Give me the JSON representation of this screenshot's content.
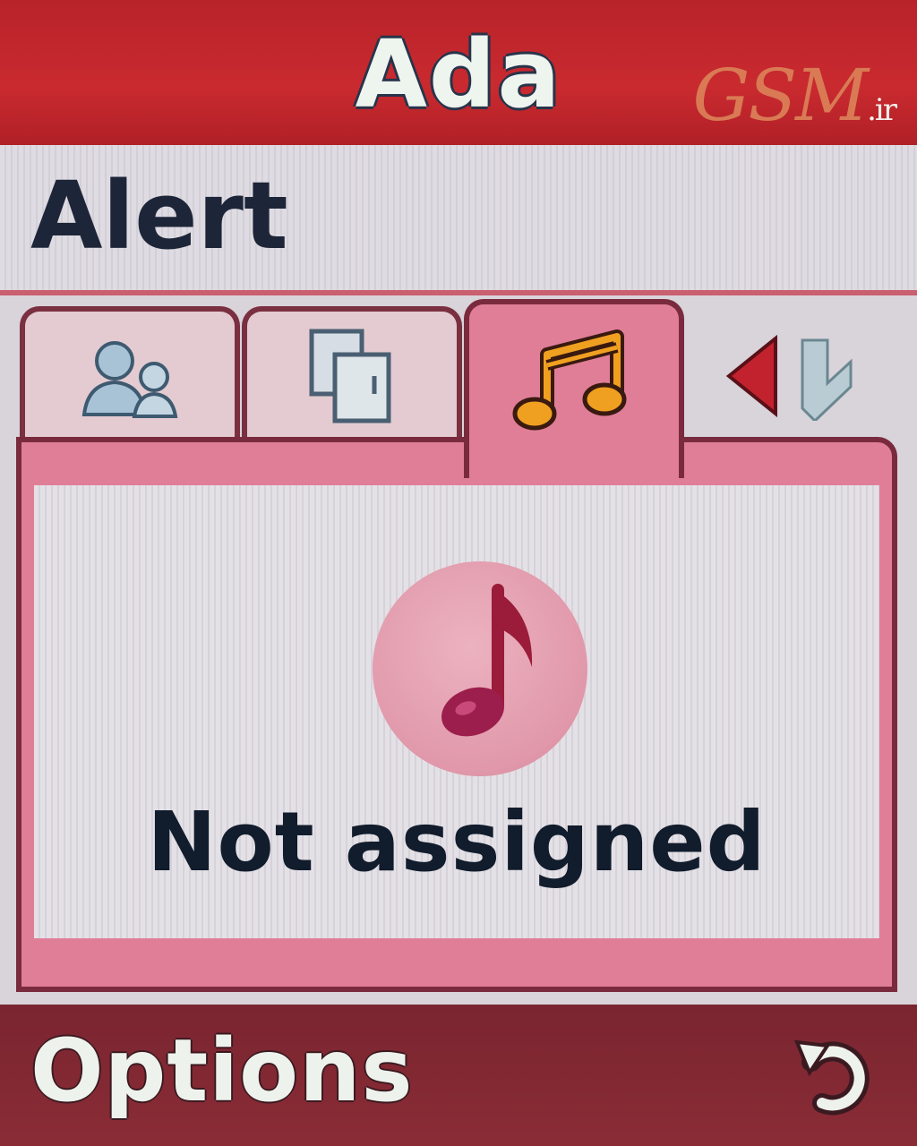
{
  "titlebar": {
    "title": "Ada",
    "watermark": "GSM",
    "watermark_tld": ".ir"
  },
  "header": {
    "label": "Alert"
  },
  "tabs": [
    {
      "icon": "contacts-icon",
      "selected": false
    },
    {
      "icon": "phonebook-icon",
      "selected": false
    },
    {
      "icon": "ringtone-icon",
      "selected": true
    }
  ],
  "panel": {
    "icon": "music-note-icon",
    "status": "Not assigned"
  },
  "softkeys": {
    "left_label": "Options",
    "right_icon": "back-icon"
  },
  "colors": {
    "titlebar": "#c92a2f",
    "accent_pink": "#e07e98",
    "softkey_bar": "#822a33",
    "text_dark": "#1d2538"
  }
}
